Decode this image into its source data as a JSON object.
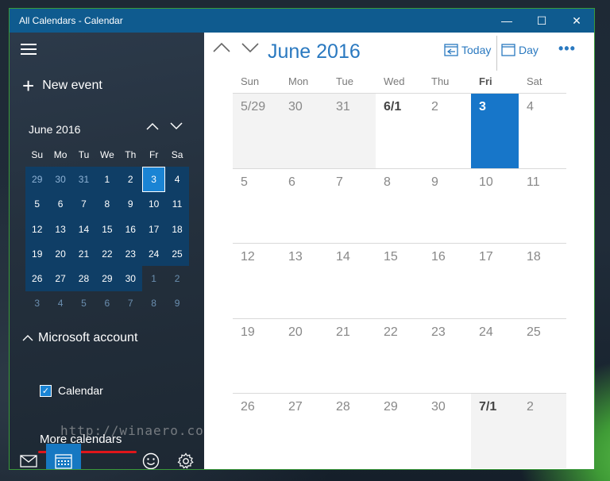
{
  "window": {
    "title": "All Calendars - Calendar",
    "min": "—",
    "max": "☐",
    "close": "✕"
  },
  "sidebar": {
    "new_event": "New event",
    "mini": {
      "month": "June 2016",
      "dows": [
        "Su",
        "Mo",
        "Tu",
        "We",
        "Th",
        "Fr",
        "Sa"
      ],
      "weeks": [
        [
          "29",
          "30",
          "31",
          "1",
          "2",
          "3",
          "4"
        ],
        [
          "5",
          "6",
          "7",
          "8",
          "9",
          "10",
          "11"
        ],
        [
          "12",
          "13",
          "14",
          "15",
          "16",
          "17",
          "18"
        ],
        [
          "19",
          "20",
          "21",
          "22",
          "23",
          "24",
          "25"
        ],
        [
          "26",
          "27",
          "28",
          "29",
          "30",
          "1",
          "2"
        ],
        [
          "3",
          "4",
          "5",
          "6",
          "7",
          "8",
          "9"
        ]
      ],
      "today": "3"
    },
    "account": "Microsoft account",
    "calendar_label": "Calendar",
    "more_calendars": "More calendars",
    "watermark": "http://winaero.com"
  },
  "main": {
    "month": "June 2016",
    "today_label": "Today",
    "day_label": "Day",
    "more": "•••",
    "dows": [
      "Sun",
      "Mon",
      "Tue",
      "Wed",
      "Thu",
      "Fri",
      "Sat"
    ],
    "weeks": [
      [
        "5/29",
        "30",
        "31",
        "6/1",
        "2",
        "3",
        "4"
      ],
      [
        "5",
        "6",
        "7",
        "8",
        "9",
        "10",
        "11"
      ],
      [
        "12",
        "13",
        "14",
        "15",
        "16",
        "17",
        "18"
      ],
      [
        "19",
        "20",
        "21",
        "22",
        "23",
        "24",
        "25"
      ],
      [
        "26",
        "27",
        "28",
        "29",
        "30",
        "7/1",
        "2"
      ]
    ]
  },
  "colors": {
    "accent": "#1776c9",
    "titlebar": "#0f5b8f",
    "sidebar": "#24303d",
    "annotation": "#e0161a"
  }
}
